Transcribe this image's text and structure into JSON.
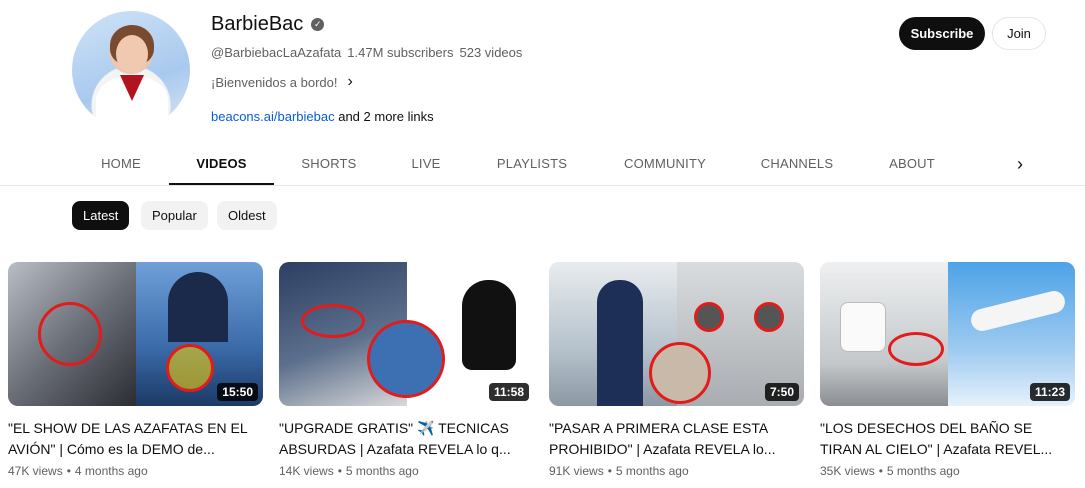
{
  "channel": {
    "name": "BarbieBac",
    "handle": "@BarbiebacLaAzafata",
    "subscribers": "1.47M subscribers",
    "videos": "523 videos",
    "description": "¡Bienvenidos a bordo!",
    "link": "beacons.ai/barbiebac",
    "more_links": "and 2 more links"
  },
  "actions": {
    "subscribe": "Subscribe",
    "join": "Join"
  },
  "tabs": [
    "HOME",
    "VIDEOS",
    "SHORTS",
    "LIVE",
    "PLAYLISTS",
    "COMMUNITY",
    "CHANNELS",
    "ABOUT"
  ],
  "active_tab": "VIDEOS",
  "chips": [
    "Latest",
    "Popular",
    "Oldest"
  ],
  "active_chip": "Latest",
  "videos": [
    {
      "title": "\"EL SHOW DE LAS AZAFATAS EN EL AVIÓN\" | Cómo es la DEMO de...",
      "views": "47K views",
      "age": "4 months ago",
      "duration": "15:50"
    },
    {
      "title": "\"UPGRADE GRATIS\" ✈️ TECNICAS ABSURDAS | Azafata REVELA lo q...",
      "views": "14K views",
      "age": "5 months ago",
      "duration": "11:58"
    },
    {
      "title": "\"PASAR A PRIMERA CLASE ESTA PROHIBIDO\" | Azafata REVELA lo...",
      "views": "91K views",
      "age": "5 months ago",
      "duration": "7:50"
    },
    {
      "title": "\"LOS DESECHOS DEL BAÑO SE TIRAN AL CIELO\" | Azafata REVEL...",
      "views": "35K views",
      "age": "5 months ago",
      "duration": "11:23"
    }
  ],
  "colors": {
    "accent_link": "#065fd4",
    "subscribe_bg": "#0f0f0f",
    "meta_text": "#606060"
  },
  "icons": {
    "verified": "verified-check-icon",
    "chevron_right": "chevron-right-icon"
  }
}
